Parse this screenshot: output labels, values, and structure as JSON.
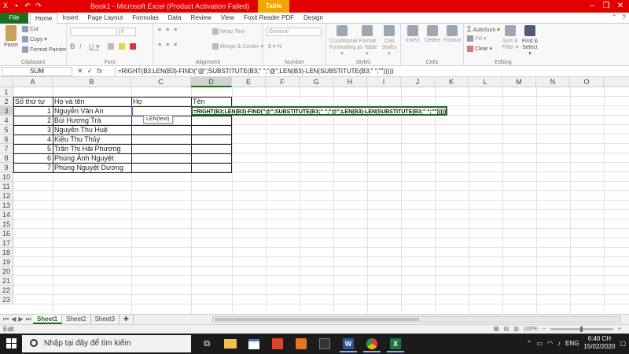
{
  "window": {
    "title": "Book1 - Microsoft Excel (Product Activation Failed)",
    "tool_tab": "Table Tools",
    "accent_color": "#e50000",
    "file_tab_color": "#1f6e1f"
  },
  "tabs": {
    "file": "File",
    "items": [
      "Home",
      "Insert",
      "Page Layout",
      "Formulas",
      "Data",
      "Review",
      "View",
      "Foxit Reader PDF",
      "Design"
    ]
  },
  "ribbon": {
    "clipboard": {
      "paste": "Paste",
      "cut": "Cut",
      "copy": "Copy ▾",
      "format_painter": "Format Painter",
      "label": "Clipboard"
    },
    "font": {
      "size": "8",
      "bold": "B",
      "italic": "I",
      "underline": "U ▾",
      "label": "Font"
    },
    "alignment": {
      "wrap": "Wrap Text",
      "merge": "Merge & Center ▾",
      "label": "Alignment"
    },
    "number": {
      "format": "General",
      "currency": "$ ▾ %",
      "label": "Number"
    },
    "styles": {
      "conditional": "Conditional Formatting ▾",
      "format_table": "Format as Table ▾",
      "cell_styles": "Cell Styles ▾",
      "label": "Styles"
    },
    "cells": {
      "insert": "Insert",
      "delete": "Delete",
      "format": "Format",
      "label": "Cells"
    },
    "editing": {
      "autosum": "AutoSum ▾",
      "fill": "Fill ▾",
      "clear": "Clear ▾",
      "sort": "Sort & Filter ▾",
      "find": "Find & Select ▾",
      "label": "Editing"
    }
  },
  "formula_bar": {
    "name_box": "SUM",
    "formula": "=RIGHT(B3;LEN(B3)-FIND(\"@\";SUBSTITUTE(B3;\" \";\"@\";LEN(B3)-LEN(SUBSTITUTE(B3;\" \";\"\")))))"
  },
  "columns": [
    "A",
    "B",
    "C",
    "D",
    "E",
    "F",
    "G",
    "H",
    "I",
    "J",
    "K",
    "L",
    "M",
    "N",
    "O"
  ],
  "rows": [
    "1",
    "2",
    "3",
    "4",
    "5",
    "6",
    "7",
    "8",
    "9",
    "10",
    "11",
    "12",
    "13",
    "14",
    "15",
    "16",
    "17",
    "18",
    "19",
    "20",
    "21",
    "22",
    "23"
  ],
  "table": {
    "headers": {
      "a": "Số thứ tự",
      "b": "Họ và tên",
      "c": "Họ",
      "d": "Tên"
    },
    "rows": [
      {
        "stt": "1",
        "name": "Nguyễn Văn An"
      },
      {
        "stt": "2",
        "name": "Bùi Hương Trà"
      },
      {
        "stt": "3",
        "name": "Nguyễn Thu Huệ"
      },
      {
        "stt": "4",
        "name": "Kiều Thu Thủy"
      },
      {
        "stt": "5",
        "name": "Trần Thị Hải Phương"
      },
      {
        "stt": "6",
        "name": "Phùng Ánh Nguyệt"
      },
      {
        "stt": "7",
        "name": "Phùng Nguyệt Dương"
      }
    ]
  },
  "editing_cell": {
    "text": "=RIGHT(B3;LEN(B3)-FIND(\"@\";SUBSTITUTE(B3;\" \";\"@\";LEN(B3)-LEN(SUBSTITUTE(B3;\" \";\"\")))))",
    "tooltip": "LEN(text)"
  },
  "sheets": [
    "Sheet1",
    "Sheet2",
    "Sheet3"
  ],
  "status": {
    "mode": "Edit",
    "zoom": "100%"
  },
  "taskbar": {
    "search_placeholder": "Nhập tại đây để tìm kiếm",
    "language": "ENG",
    "time": "6:40 CH",
    "date": "15/02/2020"
  }
}
